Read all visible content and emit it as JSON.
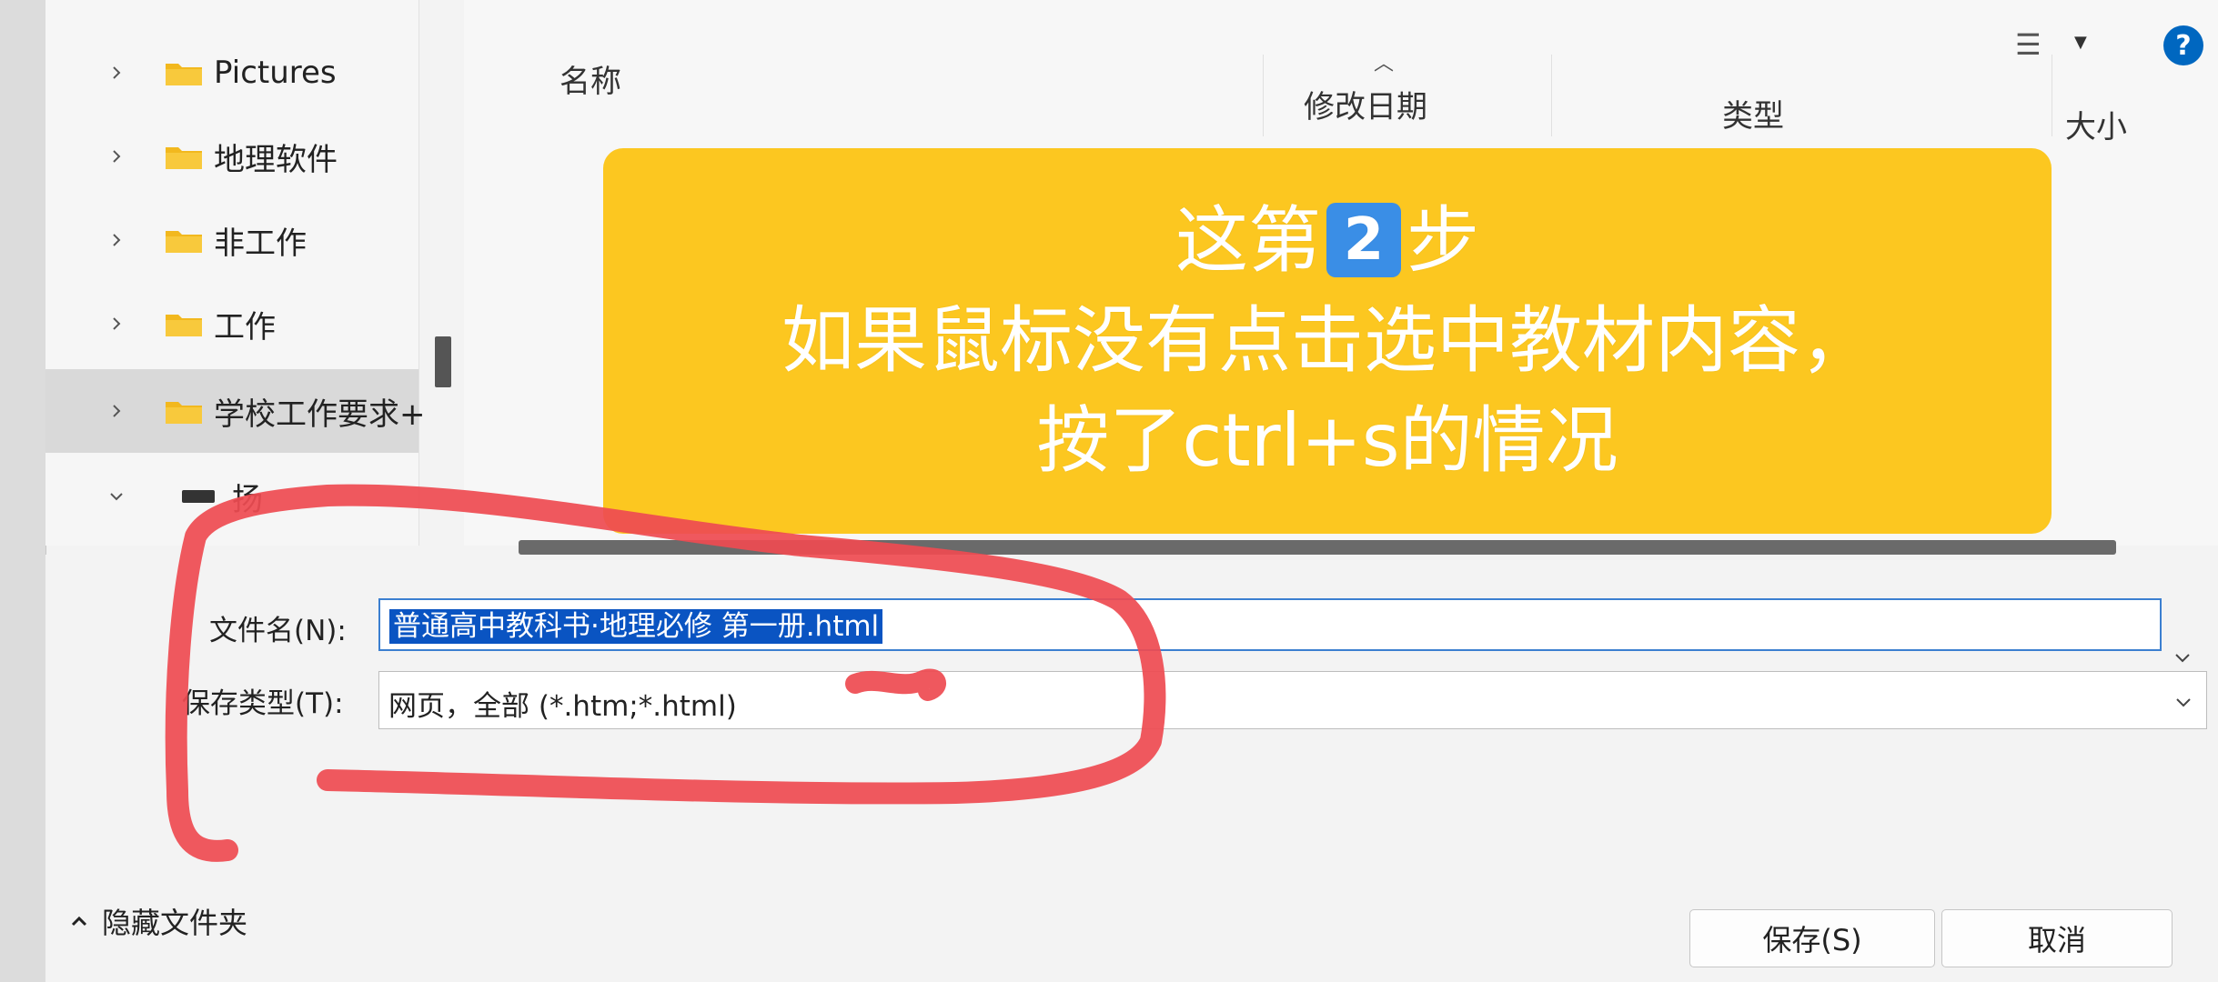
{
  "nav_tree": {
    "items": [
      {
        "label": "Pictures",
        "expanded": false,
        "selected": false
      },
      {
        "label": "地理软件",
        "expanded": false,
        "selected": false
      },
      {
        "label": "非工作",
        "expanded": false,
        "selected": false
      },
      {
        "label": "工作",
        "expanded": false,
        "selected": false
      },
      {
        "label": "学校工作要求+",
        "expanded": false,
        "selected": true
      },
      {
        "label": "扬",
        "expanded": true,
        "selected": false
      }
    ]
  },
  "columns": {
    "name": "名称",
    "modified": "修改日期",
    "type": "类型",
    "size": "大小"
  },
  "form": {
    "filename_label": "文件名(N):",
    "filename_value": "普通高中教科书·地理必修 第一册.html",
    "filetype_label": "保存类型(T):",
    "filetype_value": "网页，全部 (*.htm;*.html)"
  },
  "footer": {
    "hide_folders": "隐藏文件夹",
    "save_button": "保存(S)",
    "cancel_button": "取消"
  },
  "toolbar": {
    "help": "?"
  },
  "overlay": {
    "line1_prefix": "这第",
    "step_number": "2",
    "line1_suffix": "步",
    "line2": "如果鼠标没有点击选中教材内容，",
    "line3": "按了ctrl+s的情况",
    "background_color": "#fcc720"
  },
  "colors": {
    "selection": "#0a54c2",
    "help_button": "#0067c0",
    "annotation": "#ee4b52"
  }
}
